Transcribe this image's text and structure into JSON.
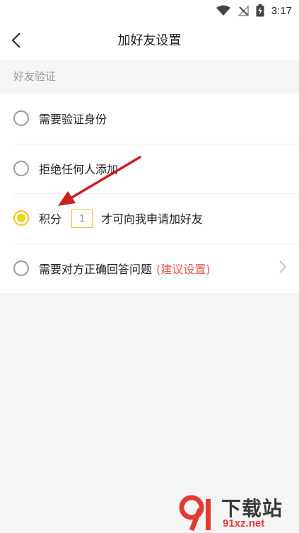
{
  "status_bar": {
    "time": "3:17",
    "icons": [
      "wifi-icon",
      "no-signal-icon",
      "battery-charging-icon"
    ]
  },
  "header": {
    "back_icon": "chevron-left-icon",
    "title": "加好友设置"
  },
  "section": {
    "title": "好友验证"
  },
  "options": {
    "verify_identity": {
      "label": "需要验证身份",
      "checked": false
    },
    "reject_all": {
      "label": "拒绝任何人添加",
      "checked": false
    },
    "points": {
      "prefix": "积分",
      "value": "1",
      "suffix": "才可向我申请加好友",
      "checked": true
    },
    "answer_question": {
      "label": "需要对方正确回答问题",
      "hint": "(建议设置)",
      "checked": false
    }
  },
  "watermark": {
    "main": "下载站",
    "sub": "91xz.net"
  },
  "colors": {
    "accent_yellow": "#f5d20d",
    "hint_red": "#e55a4a",
    "annotation_arrow": "#cc1f1f",
    "background": "#f5f5f5"
  }
}
